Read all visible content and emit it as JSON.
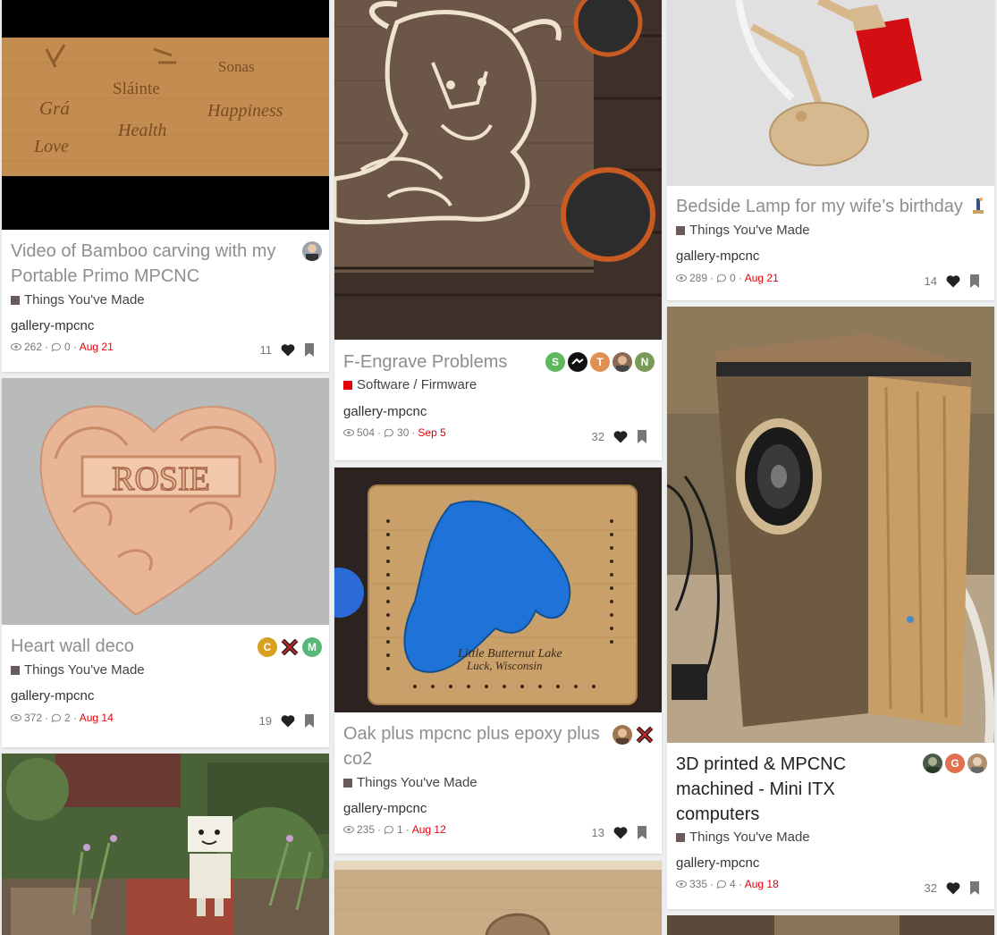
{
  "cards": [
    {
      "title": "Video of Bamboo carving with my Portable Primo MPCNC",
      "category": "Things You've Made",
      "category_color": "#6b5a5a",
      "tag": "gallery-mpcnc",
      "views": "262",
      "replies": "0",
      "date": "Aug 21",
      "likes": "11",
      "carved_words": [
        "Sonas",
        "Sláinte",
        "Grá",
        "Happiness",
        "Health",
        "Love"
      ],
      "posters": [
        {
          "initial": "",
          "color": "#9aa3ab"
        }
      ]
    },
    {
      "title": "F-Engrave Problems",
      "category": "Software / Firmware",
      "category_color": "#e3000b",
      "tag": "gallery-mpcnc",
      "views": "504",
      "replies": "30",
      "date": "Sep 5",
      "likes": "32",
      "posters": [
        {
          "initial": "S",
          "color": "#5fb85f"
        },
        {
          "initial": "",
          "color": "#111111"
        },
        {
          "initial": "T",
          "color": "#e09050"
        },
        {
          "initial": "",
          "color": "#8b6b58"
        },
        {
          "initial": "N",
          "color": "#7a9a58"
        }
      ]
    },
    {
      "title": "Bedside Lamp for my wife’s birthday",
      "category": "Things You've Made",
      "category_color": "#6b5a5a",
      "tag": "gallery-mpcnc",
      "views": "289",
      "replies": "0",
      "date": "Aug 21",
      "likes": "14",
      "posters": [
        {
          "initial": "",
          "color": "#d8c090"
        }
      ]
    },
    {
      "title": "Heart wall deco",
      "category": "Things You've Made",
      "category_color": "#6b5a5a",
      "tag": "gallery-mpcnc",
      "views": "372",
      "replies": "2",
      "date": "Aug 14",
      "likes": "19",
      "carved_text": "ROSIE",
      "posters": [
        {
          "initial": "C",
          "color": "#d8a020"
        },
        {
          "initial": "",
          "color": "#222222"
        },
        {
          "initial": "M",
          "color": "#58b878"
        }
      ]
    },
    {
      "title": "Oak plus mpcnc plus epoxy plus co2",
      "category": "Things You've Made",
      "category_color": "#6b5a5a",
      "tag": "gallery-mpcnc",
      "views": "235",
      "replies": "1",
      "date": "Aug 12",
      "likes": "13",
      "engraved_text": [
        "Little Butternut Lake",
        "Luck, Wisconsin"
      ],
      "posters": [
        {
          "initial": "",
          "color": "#a07850"
        },
        {
          "initial": "",
          "color": "#222222"
        }
      ]
    },
    {
      "title": "3D printed & MPCNC machined - Mini ITX computers",
      "category": "Things You've Made",
      "category_color": "#6b5a5a",
      "tag": "gallery-mpcnc",
      "views": "335",
      "replies": "4",
      "date": "Aug 18",
      "likes": "32",
      "posters": [
        {
          "initial": "",
          "color": "#4a5a48"
        },
        {
          "initial": "G",
          "color": "#e07050"
        },
        {
          "initial": "",
          "color": "#b09070"
        }
      ]
    }
  ]
}
